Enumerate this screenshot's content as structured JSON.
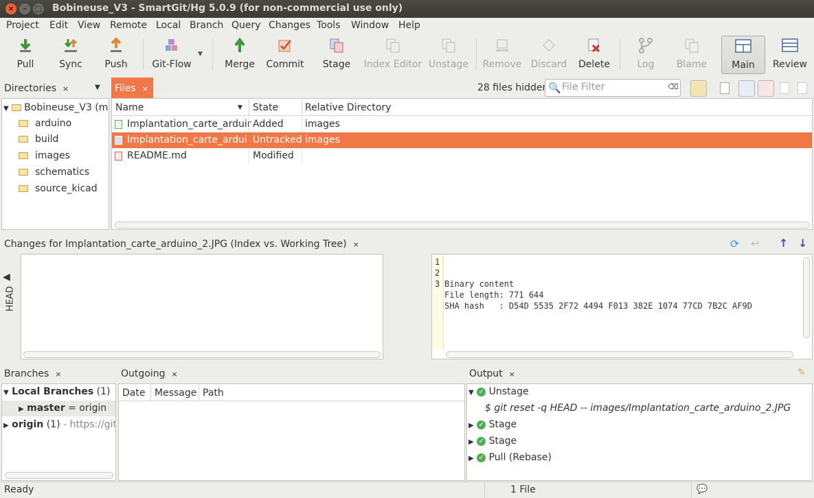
{
  "window": {
    "title": "Bobineuse_V3 - SmartGit/Hg 5.0.9 (for non-commercial use only)"
  },
  "menu": [
    "Project",
    "Edit",
    "View",
    "Remote",
    "Local",
    "Branch",
    "Query",
    "Changes",
    "Tools",
    "Window",
    "Help"
  ],
  "toolbar": {
    "pull": "Pull",
    "sync": "Sync",
    "push": "Push",
    "gitflow": "Git-Flow",
    "merge": "Merge",
    "commit": "Commit",
    "stage": "Stage",
    "index_editor": "Index Editor",
    "unstage": "Unstage",
    "remove": "Remove",
    "discard": "Discard",
    "delete": "Delete",
    "log": "Log",
    "blame": "Blame",
    "main": "Main",
    "review": "Review"
  },
  "directories": {
    "tab": "Directories",
    "root": "Bobineuse_V3 (m",
    "items": [
      "arduino",
      "build",
      "images",
      "schematics",
      "source_kicad"
    ]
  },
  "files": {
    "tab": "Files",
    "hidden": "28 files hidden",
    "filter_placeholder": "File Filter",
    "columns": {
      "name": "Name",
      "state": "State",
      "dir": "Relative Directory"
    },
    "rows": [
      {
        "name": "Implantation_carte_arduir",
        "state": "Added",
        "dir": "images"
      },
      {
        "name": "Implantation_carte_arduir",
        "state": "Untracked",
        "dir": "images"
      },
      {
        "name": "README.md",
        "state": "Modified",
        "dir": ""
      }
    ]
  },
  "changes": {
    "tab": "Changes for Implantation_carte_arduino_2.JPG (Index vs. Working Tree)",
    "head_label": "HEAD",
    "lines": [
      {
        "n": "1",
        "text": "Binary content"
      },
      {
        "n": "2",
        "text": "File length: 771 644"
      },
      {
        "n": "3",
        "text": "SHA hash   : D54D 5535 2F72 4494 F013 382E 1074 77CD 7B2C AF9D"
      }
    ]
  },
  "branches": {
    "tab": "Branches",
    "local": "Local Branches",
    "local_count": "(1)",
    "master": "master",
    "master_suffix": "= origin",
    "origin": "origin",
    "origin_count": "(1)",
    "origin_url": "- https://gith"
  },
  "outgoing": {
    "tab": "Outgoing",
    "columns": {
      "date": "Date",
      "message": "Message",
      "path": "Path"
    }
  },
  "output": {
    "tab": "Output",
    "items": [
      "Unstage",
      "Stage",
      "Stage",
      "Pull (Rebase)"
    ],
    "command": "$ git reset -q HEAD -- images/Implantation_carte_arduino_2.JPG"
  },
  "status": {
    "left": "Ready",
    "center": "1 File"
  },
  "colors": {
    "accent": "#f07746",
    "titlebar": "#3c3b37"
  }
}
